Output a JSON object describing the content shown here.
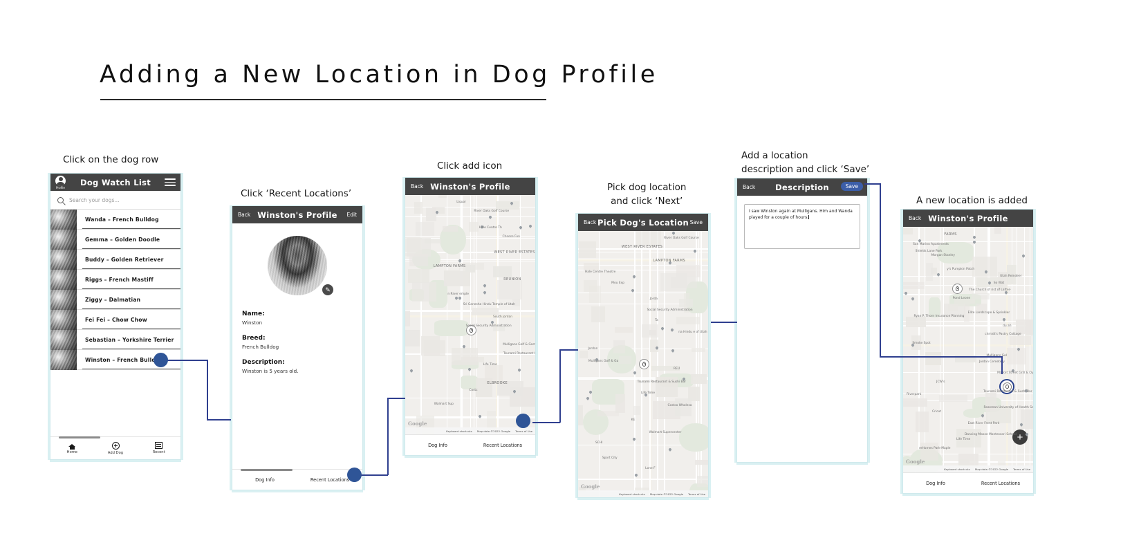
{
  "page": {
    "title": "Adding a New Location in Dog Profile"
  },
  "steps": [
    {
      "id": "step1",
      "caption": "Click on the dog row"
    },
    {
      "id": "step2",
      "caption": "Click ‘Recent Locations’"
    },
    {
      "id": "step3",
      "caption": "Click add icon"
    },
    {
      "id": "step4",
      "caption": "Pick dog location\nand click ‘Next’"
    },
    {
      "id": "step5",
      "caption": "Add a location\ndescription and click ‘Save’"
    },
    {
      "id": "step6",
      "caption": "A new location is added"
    }
  ],
  "screen1": {
    "navbar": {
      "profile_label": "Profile",
      "title": "Dog Watch List",
      "menu_icon": "hamburger-icon"
    },
    "search": {
      "placeholder": "Search your dogs...",
      "icon": "search-icon"
    },
    "dogs": [
      {
        "name": "Wanda",
        "sep": "–",
        "breed": "French Bulldog"
      },
      {
        "name": "Gemma",
        "sep": "–",
        "breed": "Golden Doodle"
      },
      {
        "name": "Buddy",
        "sep": "–",
        "breed": "Golden Retriever"
      },
      {
        "name": "Riggs",
        "sep": "–",
        "breed": "French Mastiff"
      },
      {
        "name": "Ziggy",
        "sep": "–",
        "breed": "Dalmatian"
      },
      {
        "name": "Fei Fei",
        "sep": "–",
        "breed": "Chow Chow"
      },
      {
        "name": "Sebastian",
        "sep": "–",
        "breed": "Yorkshire Terrier"
      },
      {
        "name": "Winston",
        "sep": "–",
        "breed": "French Bulldog"
      }
    ],
    "tabs": [
      {
        "label": "Home",
        "icon": "home-icon"
      },
      {
        "label": "Add Dog",
        "icon": "plus-circle-icon"
      },
      {
        "label": "Recent",
        "icon": "recent-icon"
      }
    ]
  },
  "screen2": {
    "navbar": {
      "back": "Back",
      "title": "Winston's Profile",
      "action": "Edit"
    },
    "avatar": "dog-photo",
    "edit_icon": "pencil-icon",
    "fields": [
      {
        "label": "Name:",
        "value": "Winston"
      },
      {
        "label": "Breed:",
        "value": "French Bulldog"
      },
      {
        "label": "Description:",
        "value": "Winston is 5 years old."
      }
    ],
    "tabs": [
      {
        "label": "Dog Info"
      },
      {
        "label": "Recent Locations"
      }
    ]
  },
  "screen3": {
    "navbar": {
      "back": "Back",
      "title": "Winston's Profile"
    },
    "map": {
      "labels": [
        "Liquor",
        "River Oaks Golf Course",
        "Hale Centre Th",
        "Cheese Fun",
        "WEST RIVER\nESTATES",
        "LAMPTON\nFARMS",
        "REUNION",
        "n River\nemple",
        "Sri Ganesha Hindu\nTemple of Utah",
        "South Jordan",
        "Social Security\nAdministration",
        "Mulligans Golf & Games",
        "Tsunami Restaurant\n& Sushi Bar",
        "Life Time",
        "ELBROOKE",
        "Costc",
        "Walmart Sup"
      ],
      "footer": {
        "shortcuts": "Keyboard shortcuts",
        "attribution": "Map data ©2022 Google",
        "terms": "Terms of Use",
        "watermark": "Google"
      },
      "add_icon": "plus-icon"
    },
    "tabs": [
      {
        "label": "Dog Info"
      },
      {
        "label": "Recent Locations"
      }
    ]
  },
  "screen4": {
    "navbar": {
      "back": "Back",
      "title": "Pick Dog's Location",
      "action": "Save"
    },
    "map": {
      "labels": [
        "River Oaks Golf Course",
        "WEST RIVER\nESTATES",
        "LAMPTON\nFARMS",
        "Hale Centre Theatre",
        "Mou\nExp",
        "Jorda",
        "Social Security\nAdministration",
        "Ta",
        "na Hindu\ne of Utah",
        "Jordan",
        "Mulligans Golf & Ga",
        "REU",
        "Tsunami Restaurant\n& Sushi Bar",
        "Life Time",
        "Costco Wholesa",
        "KE",
        "Walmart Supercenter",
        "SCHI",
        "Sport City",
        "Lone F"
      ],
      "footer": {
        "shortcuts": "Keyboard shortcuts",
        "attribution": "Map data ©2022 Google",
        "terms": "Terms of Use",
        "watermark": "Google"
      }
    }
  },
  "screen5": {
    "navbar": {
      "back": "Back",
      "title": "Description",
      "action": "Save"
    },
    "textarea": {
      "value": "I saw Winston again at Mulligans. Him and Wanda played for a couple of hours."
    }
  },
  "screen6": {
    "navbar": {
      "back": "Back",
      "title": "Winston's Profile"
    },
    "map": {
      "labels": [
        "FARMS",
        "San Marino Apartments",
        "Shields Lane Park",
        "Morgan Stanley",
        "y's Pumpkin Patch",
        "Utah Reindeer",
        "So\nWat",
        "The Church of\nrist of Latter-",
        "Pond Leone",
        "Elite Landscape\n& Sprinkler",
        "Ryan P. Thorn\nInsurance Planning",
        "du\nah",
        "chmidt's Pastry Cottage",
        "Smoke Spot",
        "Mulligans Gol",
        "Jordan Cemetery",
        "Market Street Grill &\nOyster Bar - South Jordan",
        "JCW's",
        "Tsunami Restaurant\n& Sushi Bar",
        "Riverpark",
        "Roseman University\nof Health Sciences",
        "Cricut",
        "East River Front Park",
        "Dancing Moose\nMontessori School",
        "Life Time",
        "reHomes\nPark-Maple"
      ],
      "footer": {
        "shortcuts": "Keyboard shortcuts",
        "attribution": "Map data ©2022 Google",
        "terms": "Terms of Use",
        "watermark": "Google"
      },
      "add_icon": "plus-icon"
    },
    "tabs": [
      {
        "label": "Dog Info"
      },
      {
        "label": "Recent Locations"
      }
    ]
  },
  "colors": {
    "navbar": "#444444",
    "accent": "#2f5597",
    "frame_glow": "#d9f0f2",
    "save_button": "#3c5ea8"
  }
}
